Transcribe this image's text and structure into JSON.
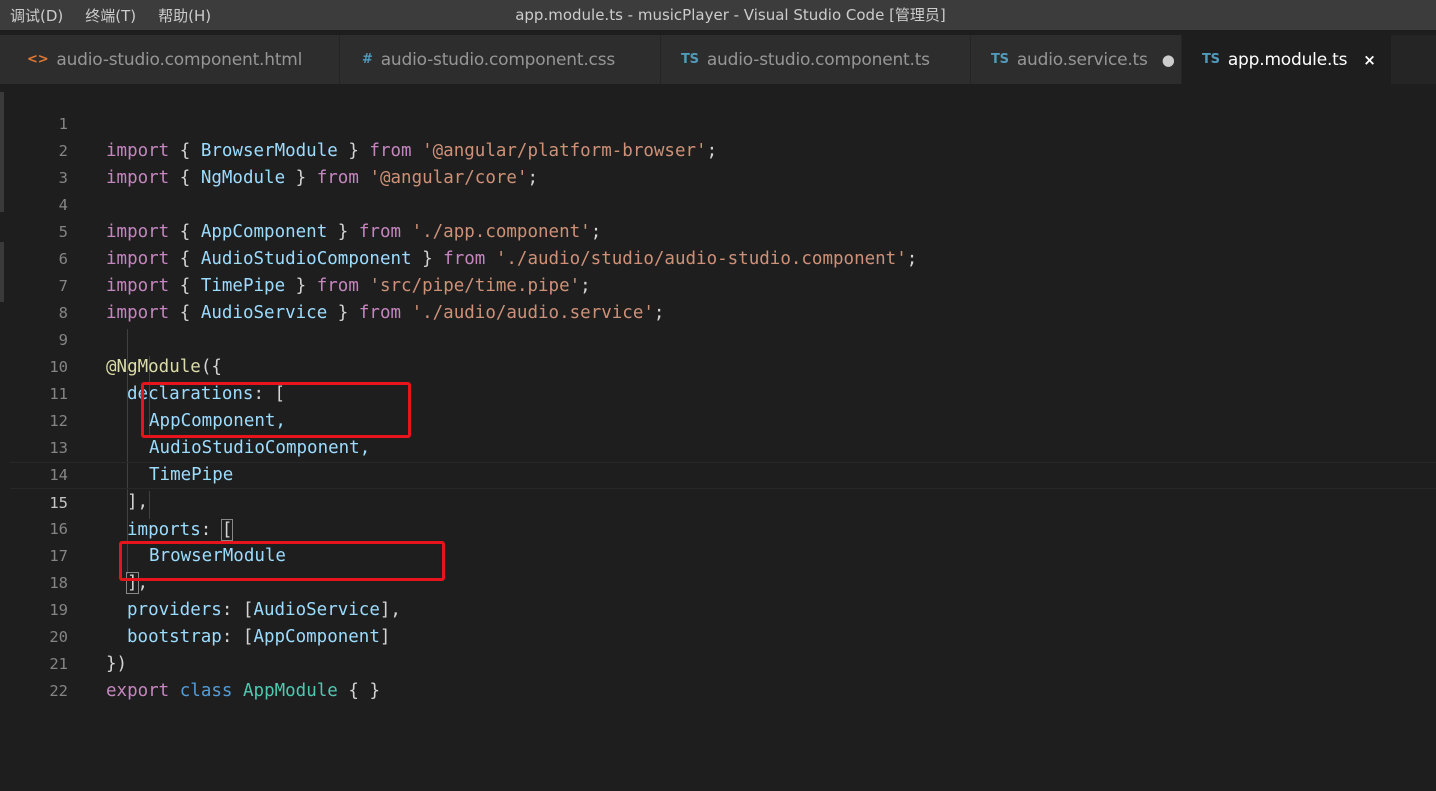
{
  "titlebar": {
    "menu": [
      "调试(D)",
      "终端(T)",
      "帮助(H)"
    ],
    "window_title": "app.module.ts - musicPlayer - Visual Studio Code [管理员]"
  },
  "tabs": [
    {
      "icon": "<>",
      "label": "audio-studio.component.html"
    },
    {
      "icon": "#",
      "label": "audio-studio.component.css"
    },
    {
      "icon": "TS",
      "label": "audio-studio.component.ts"
    },
    {
      "icon": "TS",
      "label": "audio.service.ts",
      "modified_marker": "●"
    },
    {
      "icon": "TS",
      "label": "app.module.ts",
      "close_glyph": "×"
    }
  ],
  "editor": {
    "current_line": 15,
    "line_numbers": [
      "1",
      "2",
      "3",
      "4",
      "5",
      "6",
      "7",
      "8",
      "9",
      "10",
      "11",
      "12",
      "13",
      "14",
      "15",
      "16",
      "17",
      "18",
      "19",
      "20",
      "21",
      "22"
    ],
    "lines": [
      {
        "import": "import",
        "lb": " { ",
        "name": "BrowserModule",
        "rb": " } ",
        "from": "from",
        "sp": " ",
        "path": "'@angular/platform-browser'",
        "end": ";"
      },
      {
        "import": "import",
        "lb": " { ",
        "name": "NgModule",
        "rb": " } ",
        "from": "from",
        "sp": " ",
        "path": "'@angular/core'",
        "end": ";"
      },
      {
        "import": "import",
        "lb": " { ",
        "name": "AppComponent",
        "rb": " } ",
        "from": "from",
        "sp": " ",
        "path": "'./app.component'",
        "end": ";"
      },
      {
        "import": "import",
        "lb": " { ",
        "name": "AudioStudioComponent",
        "rb": " } ",
        "from": "from",
        "sp": " ",
        "path": "'./audio/studio/audio-studio.component'",
        "end": ";"
      },
      {
        "import": "import",
        "lb": " { ",
        "name": "TimePipe",
        "rb": " } ",
        "from": "from",
        "sp": " ",
        "path": "'src/pipe/time.pipe'",
        "end": ";"
      },
      {
        "import": "import",
        "lb": " { ",
        "name": "AudioService",
        "rb": " } ",
        "from": "from",
        "sp": " ",
        "path": "'./audio/audio.service'",
        "end": ";"
      }
    ],
    "decorator": "@NgModule",
    "decorator_open": "({",
    "declarations_key": "declarations",
    "colon_bracket": ": [",
    "decl_items": [
      "AppComponent,",
      "AudioStudioComponent,",
      "TimePipe"
    ],
    "close_bracket_comma": "],",
    "imports_key": "imports",
    "colon_space": ": ",
    "open_bracket": "[",
    "imports_item": "BrowserModule",
    "imports_close": "]",
    "comma": ",",
    "providers_key": "providers",
    "providers_value": "AudioService",
    "bootstrap_key": "bootstrap",
    "bootstrap_value": "AppComponent",
    "close_bracket": "]",
    "decorator_close": "})",
    "export_kw": "export",
    "class_kw": "class",
    "class_name": "AppModule",
    "class_body": "{ }"
  }
}
